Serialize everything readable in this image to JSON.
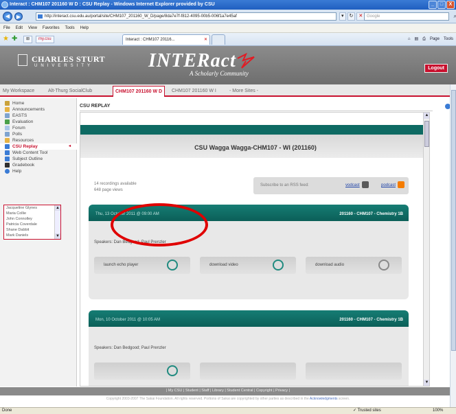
{
  "browser": {
    "title": "Interact : CHM107 201160 W D : CSU Replay - Windows Internet Explorer provided by CSU",
    "window_buttons": [
      "_",
      "□",
      "X"
    ],
    "nav_back": "◀",
    "nav_forward": "▶",
    "address": "http://interact.csu.edu.au/portal/site/CHM107_201160_W_D/page/8da7e7f-f812-4095-00b5-006f1a7e45af",
    "address_tools": [
      "▾",
      "↻",
      "✕"
    ],
    "search_placeholder": "Google",
    "menu": [
      "File",
      "Edit",
      "View",
      "Favorites",
      "Tools",
      "Help"
    ],
    "tab_small_1": "⊞",
    "tab_small_2": "my.csu",
    "active_tab": "Interact : CHM107 20116...",
    "tab_close": "✕",
    "cmd_home": "⌂",
    "cmd_feeds": "▤",
    "cmd_print": "⎙",
    "cmd_page": "Page",
    "cmd_tools": "Tools",
    "status_left": "Done",
    "status_zone": "Trusted sites",
    "status_zoom": "100%"
  },
  "header": {
    "brand_name": "CHARLES STURT",
    "brand_sub": "UNIVERSITY",
    "app_logo": "INTERact",
    "tagline": "A Scholarly Community",
    "logout": "Logout"
  },
  "site_tabs": [
    "My Workspace",
    "Alt-Thurg SocialClub",
    "CHM107 201160 W D",
    "CHM107 201160 W I",
    "- More Sites -"
  ],
  "leftnav": [
    {
      "label": "Home",
      "color": "#caa23a"
    },
    {
      "label": "Announcements",
      "color": "#e7b343"
    },
    {
      "label": "EASTS",
      "color": "#7fa4d0"
    },
    {
      "label": "Evaluation",
      "color": "#4aa04a"
    },
    {
      "label": "Forum",
      "color": "#aac6e8"
    },
    {
      "label": "Polls",
      "color": "#7fa4d0"
    },
    {
      "label": "Resources",
      "color": "#e7b343"
    },
    {
      "label": "CSU Replay",
      "color": "#3a7bd5"
    },
    {
      "label": "Web Content Tool",
      "color": "#3a7bd5"
    },
    {
      "label": "Subject Outline",
      "color": "#3a7bd5"
    },
    {
      "label": "Gradebook",
      "color": "#2f2f2f"
    },
    {
      "label": "Help",
      "color": "#3a7bd5"
    }
  ],
  "nav_active_arrow": "◂",
  "people": [
    "Jacqueline Glynes",
    "Maria Collie",
    "John Connolley",
    "Patricia Coverdale",
    "Shane Dabbit",
    "Mark Daniels"
  ],
  "people_up": "▲",
  "people_down": "▼",
  "content": {
    "section_title": "CSU REPLAY",
    "course_title": "CSU Wagga Wagga-CHM107 - WI (201160)",
    "recordings": "14 recordings available",
    "page_views": "648 page views",
    "rss_label": "Subscribe to an RSS feed:",
    "rss_vodcast": "vodcast",
    "rss_podcast": "podcast",
    "scroll_up": "▲",
    "scroll_down": "▼"
  },
  "cards": [
    {
      "date": "Thu, 13 October 2011 @ 09:00 AM",
      "course": "201160 - CHM107 - Chemistry 1B",
      "speakers": "Speakers: Dan Bedgood; Paul Prenzler",
      "launch": "launch echo player",
      "video": "download video",
      "audio": "download audio"
    },
    {
      "date": "Mon, 10 October 2011 @ 10:05 AM",
      "course": "201160 - CHM107 - Chemistry 1B",
      "speakers": "Speakers: Dan Bedgood; Paul Prenzler"
    }
  ],
  "footer": {
    "links": "| My CSU | Student | Staff | Library | Student Central | Copyright | Privacy |",
    "copyright": "Copyright 2003-2007 The Sakai Foundation. All rights reserved. Portions of Sakai are copyrighted by other parties as described in the",
    "ack_link": "Acknowledgments",
    "copyright_end": "screen."
  },
  "colors": {
    "csu_red": "#c8102e",
    "teal": "#0e6a63",
    "highlight": "#e00000"
  }
}
